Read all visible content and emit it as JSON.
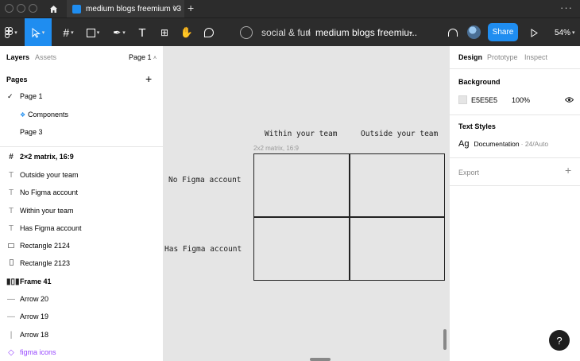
{
  "titlebar": {
    "tab_title": "medium blogs freemium v3"
  },
  "toolbar": {
    "team": "social & fun",
    "separator": "/",
    "file_name": "medium blogs freemiu...",
    "share_label": "Share",
    "zoom": "54%"
  },
  "left_panel": {
    "tabs": [
      "Layers",
      "Assets"
    ],
    "page_selector": "Page 1",
    "pages_heading": "Pages",
    "pages": [
      {
        "label": "Page 1",
        "selected": true
      },
      {
        "label": "Components",
        "selected": false
      },
      {
        "label": "Page 3",
        "selected": false
      }
    ],
    "layers": [
      {
        "label": "2×2 matrix, 16:9",
        "icon": "frame-icon"
      },
      {
        "label": "Outside your team",
        "icon": "text-icon"
      },
      {
        "label": "No Figma account",
        "icon": "text-icon"
      },
      {
        "label": "Within your team",
        "icon": "text-icon"
      },
      {
        "label": "Has Figma account",
        "icon": "text-icon"
      },
      {
        "label": "Rectangle 2124",
        "icon": "rectangle-icon"
      },
      {
        "label": "Rectangle 2123",
        "icon": "rectangle-icon"
      },
      {
        "label": "Frame 41",
        "icon": "auto-layout-icon"
      },
      {
        "label": "Arrow 20",
        "icon": "arrow-icon"
      },
      {
        "label": "Arrow 19",
        "icon": "arrow-icon"
      },
      {
        "label": "Arrow 18",
        "icon": "arrow-icon"
      },
      {
        "label": "figma icons",
        "icon": "component-icon"
      }
    ]
  },
  "canvas": {
    "col_headers": [
      "Within your team",
      "Outside your team"
    ],
    "row_headers": [
      "No Figma account",
      "Has Figma account"
    ],
    "frame_label": "2x2 matrix, 16:9"
  },
  "right_panel": {
    "tabs": [
      "Design",
      "Prototype",
      "Inspect"
    ],
    "background_heading": "Background",
    "bg_hex": "E5E5E5",
    "bg_opacity": "100%",
    "text_styles_heading": "Text Styles",
    "text_style_preview": "Ag",
    "text_style_name": "Documentation",
    "text_style_meta": "· 24/Auto",
    "export_heading": "Export"
  },
  "help_label": "?",
  "colors": {
    "accent": "#1f8df0",
    "chrome": "#2c2c2c",
    "canvas_bg": "#e5e5e5",
    "component_purple": "#9747ff"
  }
}
